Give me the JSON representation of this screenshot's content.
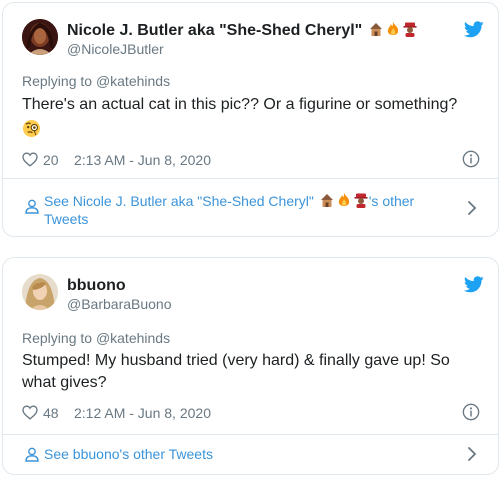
{
  "tweets": [
    {
      "display_name": "Nicole J. Butler aka \"She-Shed Cheryl\"",
      "handle": "@NicoleJButler",
      "reply_prefix": "Replying to ",
      "reply_to": "@katehinds",
      "text": "There's an actual cat in this pic?? Or a figurine or something?",
      "likes": "20",
      "timestamp": "2:13 AM - Jun 8, 2020",
      "footer_prefix": "See Nicole J. Butler aka \"She-Shed Cheryl\"",
      "footer_suffix": "'s other",
      "footer_line2": "Tweets",
      "name_emojis": [
        "house-icon",
        "fire-icon",
        "person-with-hat-icon"
      ],
      "body_emoji": "face-with-monocle-icon"
    },
    {
      "display_name": "bbuono",
      "handle": "@BarbaraBuono",
      "reply_prefix": "Replying to ",
      "reply_to": "@katehinds",
      "text": "Stumped! My husband tried (very hard) & finally gave up! So what gives?",
      "likes": "48",
      "timestamp": "2:12 AM - Jun 8, 2020",
      "footer_text": "See bbuono's other Tweets"
    }
  ],
  "colors": {
    "link": "#3b94d9",
    "muted": "#697882",
    "border": "#e1e8ed",
    "twitter_blue": "#1da1f2"
  }
}
